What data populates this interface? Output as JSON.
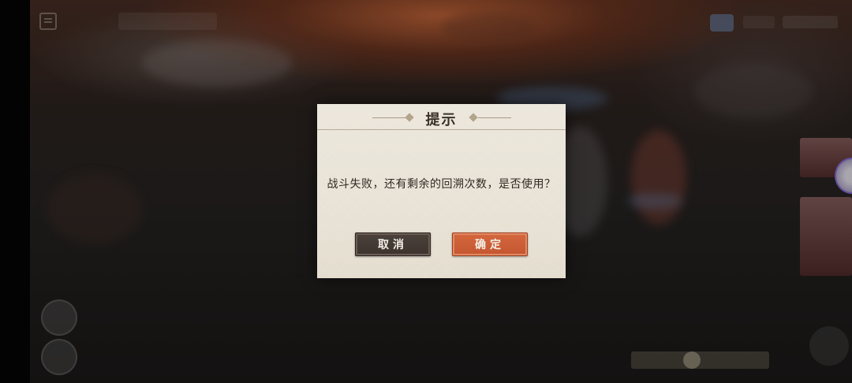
{
  "dialog": {
    "title": "提示",
    "message": "战斗失败，还有剩余的回溯次数，是否使用？",
    "cancel_label": "取消",
    "confirm_label": "确定"
  },
  "colors": {
    "confirm_button": "#c95a33",
    "cancel_button": "#433833",
    "dialog_background": "#ebe5da",
    "dialog_text": "#2f2822"
  },
  "icons": {
    "menu": "menu-icon",
    "title_ornament": "diamond-ornament-icon"
  }
}
